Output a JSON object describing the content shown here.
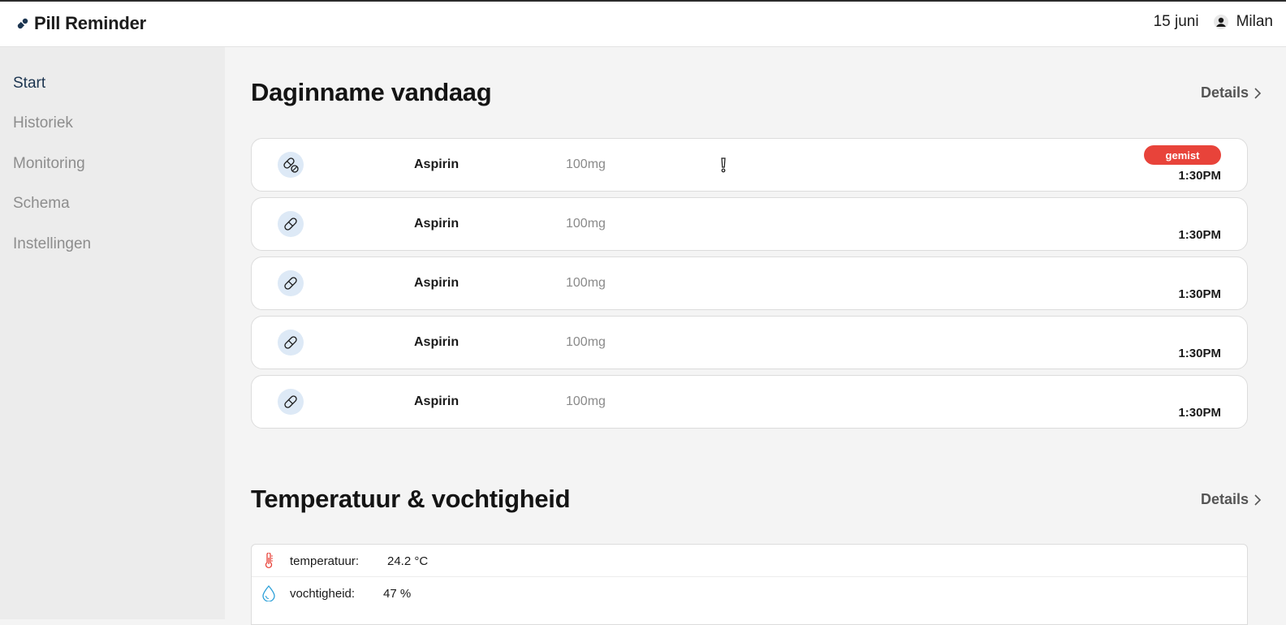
{
  "header": {
    "app_name": "Pill Reminder",
    "date": "15 juni",
    "user_name": "Milan"
  },
  "sidebar": {
    "items": [
      {
        "label": "Start",
        "active": true
      },
      {
        "label": "Historiek",
        "active": false
      },
      {
        "label": "Monitoring",
        "active": false
      },
      {
        "label": "Schema",
        "active": false
      },
      {
        "label": "Instellingen",
        "active": false
      }
    ]
  },
  "intake": {
    "title": "Daginname vandaag",
    "details_label": "Details",
    "items": [
      {
        "name": "Aspirin",
        "dose": "100mg",
        "time": "1:30PM",
        "status": "gemist",
        "icon": "pill-partial-icon",
        "warning": true
      },
      {
        "name": "Aspirin",
        "dose": "100mg",
        "time": "1:30PM",
        "icon": "pill-icon"
      },
      {
        "name": "Aspirin",
        "dose": "100mg",
        "time": "1:30PM",
        "icon": "pill-icon"
      },
      {
        "name": "Aspirin",
        "dose": "100mg",
        "time": "1:30PM",
        "icon": "pill-icon"
      },
      {
        "name": "Aspirin",
        "dose": "100mg",
        "time": "1:30PM",
        "icon": "pill-icon"
      }
    ]
  },
  "sensors": {
    "title": "Temperatuur & vochtigheid",
    "details_label": "Details",
    "temperature": {
      "label": "temperatuur:",
      "value": "24.2 °C",
      "icon": "thermometer-icon"
    },
    "humidity": {
      "label": "vochtigheid:",
      "value": "47 %",
      "icon": "water-drop-icon"
    }
  },
  "colors": {
    "accent": "#1c3550",
    "missed_badge": "#e8433a",
    "pill_circle": "#dde9f6",
    "thermometer": "#e8433a",
    "drop": "#2a9fd8"
  }
}
